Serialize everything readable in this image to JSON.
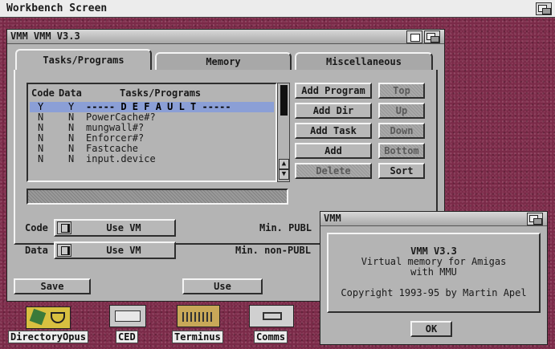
{
  "screen": {
    "title": "Workbench Screen"
  },
  "main_window": {
    "title": "VMM VMM V3.3",
    "tabs": [
      {
        "label": "Tasks/Programs",
        "active": true
      },
      {
        "label": "Memory",
        "active": false
      },
      {
        "label": "Miscellaneous",
        "active": false
      }
    ],
    "list": {
      "headers": {
        "code": "Code",
        "data": "Data",
        "name": "Tasks/Programs"
      },
      "rows": [
        {
          "code": "Y",
          "data": "Y",
          "name": "----- D E F A U L T -----",
          "selected": true
        },
        {
          "code": "N",
          "data": "N",
          "name": "PowerCache#?",
          "selected": false
        },
        {
          "code": "N",
          "data": "N",
          "name": "mungwall#?",
          "selected": false
        },
        {
          "code": "N",
          "data": "N",
          "name": "Enforcer#?",
          "selected": false
        },
        {
          "code": "N",
          "data": "N",
          "name": "Fastcache",
          "selected": false
        },
        {
          "code": "N",
          "data": "N",
          "name": "input.device",
          "selected": false
        }
      ]
    },
    "side_buttons": {
      "add_program": "Add Program",
      "add_dir": "Add Dir",
      "add_task": "Add Task",
      "add": "Add",
      "delete": "Delete",
      "top": "Top",
      "up": "Up",
      "down": "Down",
      "bottom": "Bottom",
      "sort": "Sort"
    },
    "code_row": {
      "label": "Code",
      "cycle_value": "Use VM",
      "min_label": "Min. PUBL"
    },
    "data_row": {
      "label": "Data",
      "cycle_value": "Use VM",
      "min_label": "Min. non-PUBL"
    },
    "footer": {
      "save": "Save",
      "use": "Use"
    }
  },
  "about_window": {
    "title": "VMM",
    "lines": [
      "VMM V3.3",
      "Virtual memory for Amigas",
      "with MMU",
      "Copyright 1993-95 by Martin Apel"
    ],
    "ok": "OK"
  },
  "desktop_icons": [
    {
      "label": "DirectoryOpus"
    },
    {
      "label": "CED"
    },
    {
      "label": "Terminus"
    },
    {
      "label": "Comms"
    }
  ],
  "colors": {
    "selection": "#8b9fd6",
    "window_gray": "#b4b4b4",
    "desktop": "#7a2a48"
  }
}
